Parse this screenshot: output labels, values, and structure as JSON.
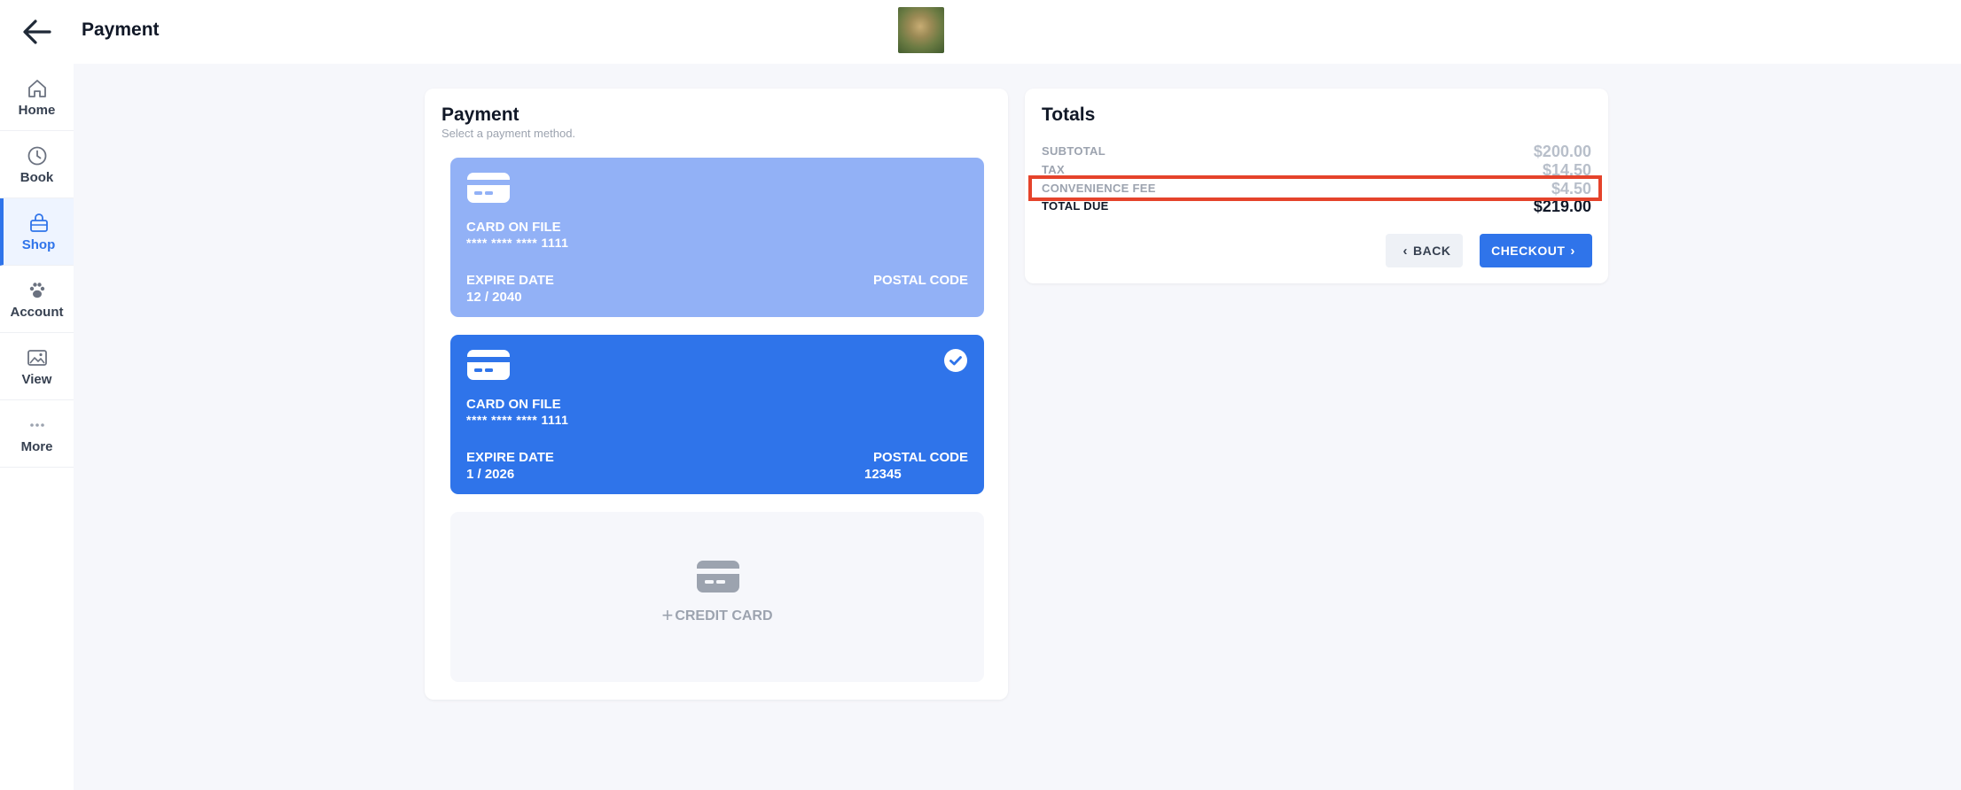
{
  "header": {
    "title": "Payment"
  },
  "sidebar": {
    "items": [
      {
        "label": "Home",
        "icon": "home-icon"
      },
      {
        "label": "Book",
        "icon": "clock-icon"
      },
      {
        "label": "Shop",
        "icon": "shop-bag-icon",
        "active": true
      },
      {
        "label": "Account",
        "icon": "paw-icon"
      },
      {
        "label": "View",
        "icon": "image-icon"
      },
      {
        "label": "More",
        "icon": "more-dots-icon"
      }
    ]
  },
  "payment": {
    "title": "Payment",
    "subtitle": "Select a payment method.",
    "cards": [
      {
        "label": "CARD ON FILE",
        "number": "**** **** **** 1111",
        "expire_label": "EXPIRE DATE",
        "expire_value": "12 / 2040",
        "postal_label": "POSTAL CODE",
        "postal_value": "",
        "selected": false
      },
      {
        "label": "CARD ON FILE",
        "number": "**** **** **** 1111",
        "expire_label": "EXPIRE DATE",
        "expire_value": "1 / 2026",
        "postal_label": "POSTAL CODE",
        "postal_value": "12345",
        "selected": true
      }
    ],
    "add_card": {
      "plus": "+",
      "label": "CREDIT CARD"
    }
  },
  "totals": {
    "title": "Totals",
    "rows": [
      {
        "label": "SUBTOTAL",
        "value": "$200.00"
      },
      {
        "label": "TAX",
        "value": "$14.50"
      },
      {
        "label": "CONVENIENCE FEE",
        "value": "$4.50"
      },
      {
        "label": "TOTAL DUE",
        "value": "$219.00"
      }
    ],
    "back_label": "BACK",
    "checkout_label": "CHECKOUT"
  },
  "colors": {
    "accent": "#2f74ea",
    "card_light": "#92b1f6",
    "highlight": "#e5432b",
    "background": "#f6f7fb"
  }
}
